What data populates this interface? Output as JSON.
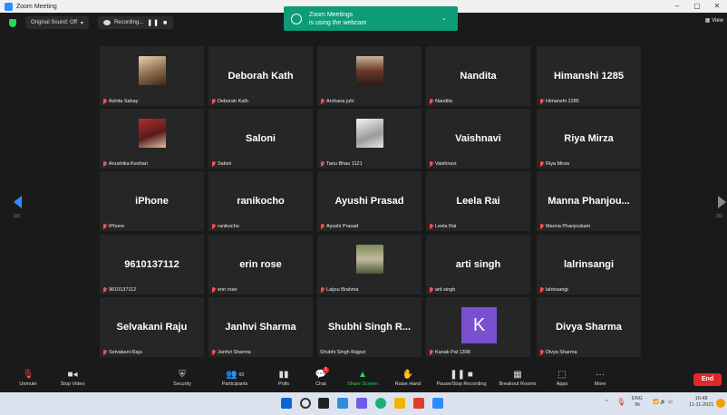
{
  "window": {
    "title": "Zoom Meeting",
    "controls": [
      "–",
      "▢",
      "✕"
    ]
  },
  "topbar": {
    "original_sound": "Original Sound: Off",
    "original_sound_chevron": "▾",
    "recording": "Recording...",
    "pause": "❚❚",
    "stop": "■",
    "view": "▦ View"
  },
  "toast": {
    "line1": "Zoom Meetings",
    "line2": "is using the webcam",
    "chevron": "⌄"
  },
  "pagination": {
    "left": "3/3",
    "right": "3/3"
  },
  "tiles": [
    {
      "big": "",
      "label": "Ashita Sahay",
      "photo": true,
      "muted": true
    },
    {
      "big": "Deborah Kath",
      "label": "Deborah Kath",
      "muted": true
    },
    {
      "big": "",
      "label": "Archana juhi",
      "photo": true,
      "muted": true
    },
    {
      "big": "Nandita",
      "label": "Nandita",
      "muted": true
    },
    {
      "big": "Himanshi 1285",
      "label": "Himanshi 1285",
      "muted": true
    },
    {
      "big": "",
      "label": "Anushika Keshari",
      "photo": true,
      "muted": true
    },
    {
      "big": "Saloni",
      "label": "Saloni",
      "muted": true
    },
    {
      "big": "",
      "label": "Tanu Bhau 1121",
      "photo": true,
      "muted": true
    },
    {
      "big": "Vaishnavi",
      "label": "Vaishnavi",
      "muted": true
    },
    {
      "big": "Riya Mirza",
      "label": "Riya Mirza",
      "muted": true
    },
    {
      "big": "iPhone",
      "label": "iPhone",
      "muted": true
    },
    {
      "big": "ranikocho",
      "label": "ranikocho",
      "muted": true
    },
    {
      "big": "Ayushi Prasad",
      "label": "Ayushi Prasad",
      "muted": true
    },
    {
      "big": "Leela Rai",
      "label": "Leela Rai",
      "muted": true
    },
    {
      "big": "Manna Phanjou...",
      "label": "Manna Phanjoubam",
      "muted": true
    },
    {
      "big": "9610137112",
      "label": "9610137112",
      "muted": true
    },
    {
      "big": "erin rose",
      "label": "erin rose",
      "muted": true
    },
    {
      "big": "",
      "label": "Laijou Brahma",
      "photo": true,
      "muted": true
    },
    {
      "big": "arti singh",
      "label": "arti singh",
      "muted": true
    },
    {
      "big": "lalrinsangi",
      "label": "lalrinsangi",
      "muted": true
    },
    {
      "big": "Selvakani Raju",
      "label": "Selvakani Raju",
      "muted": true
    },
    {
      "big": "Janhvi Sharma",
      "label": "Janhvi Sharma",
      "muted": true
    },
    {
      "big": "Shubhi Singh R...",
      "label": "Shubhi Singh Rajput",
      "muted": false
    },
    {
      "big": "",
      "label": "Kanak Pal 1398",
      "avatar": "K",
      "muted": true
    },
    {
      "big": "Divya Sharma",
      "label": "Divya Sharma",
      "muted": true
    }
  ],
  "toolbar": {
    "unmute": "Unmute",
    "stop_video": "Stop Video",
    "security": "Security",
    "participants": "Participants",
    "participants_count": "69",
    "polls": "Polls",
    "chat": "Chat",
    "chat_badge": "1",
    "share_screen": "Share Screen",
    "raise_hand": "Raise Hand",
    "pause_recording": "Pause/Stop Recording",
    "breakout": "Breakout Rooms",
    "apps": "Apps",
    "more": "More",
    "end": "End"
  },
  "taskbar": {
    "lang1": "ENG",
    "lang2": "IN",
    "time": "16:48",
    "date": "11-11-2021",
    "chevron": "^"
  },
  "colors": {
    "zoom_blue": "#2d8cff",
    "share_green": "#23d959",
    "end_red": "#e02828",
    "toast_green": "#0e9b78",
    "avatar_purple": "#7a4fd0"
  }
}
